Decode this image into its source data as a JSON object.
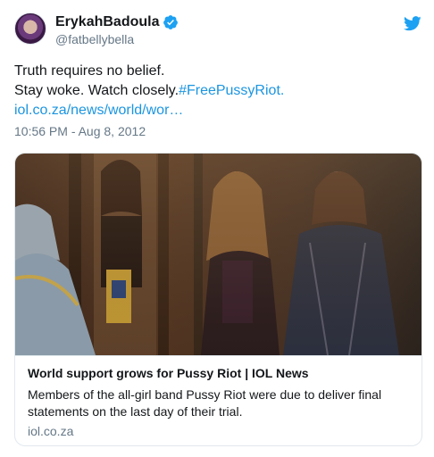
{
  "author": {
    "display_name": "ErykahBadoula",
    "handle": "@fatbellybella",
    "verified": true,
    "avatar_icon": "user-avatar"
  },
  "tweet": {
    "line1": "Truth requires no belief.",
    "line2_text": "Stay woke. Watch closely.",
    "hashtag": "#FreePussyRiot.",
    "link": "iol.co.za/news/world/wor…",
    "timestamp": "10:56 PM - Aug 8, 2012"
  },
  "card": {
    "title": "World support grows for Pussy Riot | IOL News",
    "description_line1": "Members of the all-girl band Pussy Riot were due to deliver final",
    "description_line2": "statements on the last day of their trial.",
    "domain": "iol.co.za",
    "image_icon": "courtroom-photo"
  },
  "icons": {
    "verified": "verified-badge-icon",
    "brand": "twitter-bird-icon"
  },
  "colors": {
    "link": "#1b95e0",
    "secondary_text": "#657786",
    "border": "#e1e8ed",
    "verified": "#1da1f2"
  }
}
